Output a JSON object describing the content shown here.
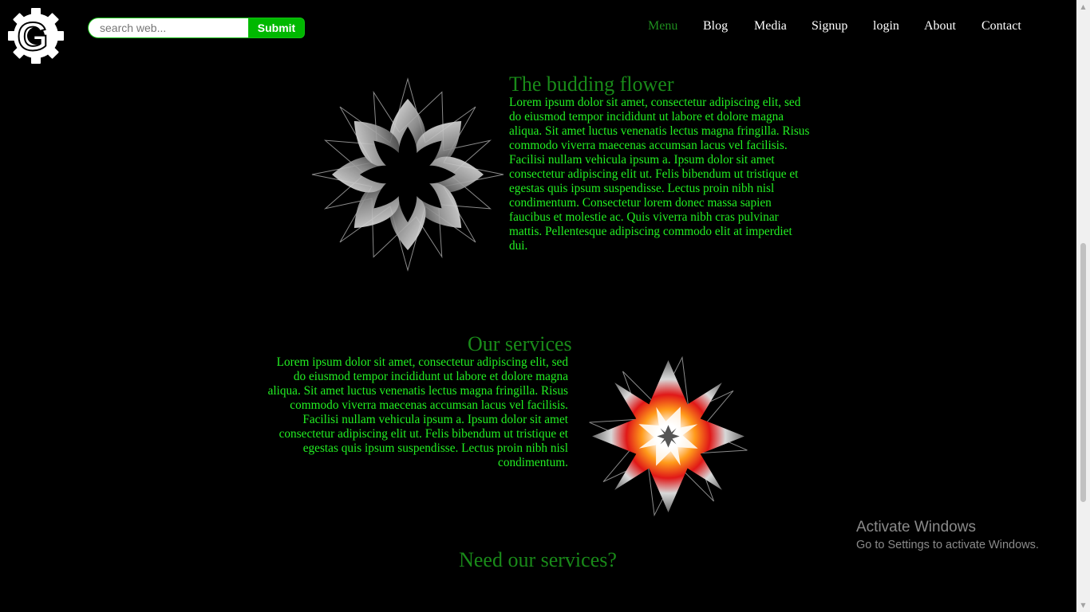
{
  "header": {
    "logo_letter": "G",
    "search": {
      "placeholder": "search web...",
      "value": ""
    },
    "submit_label": "Submit",
    "nav": [
      {
        "label": "Menu",
        "active": true
      },
      {
        "label": "Blog",
        "active": false
      },
      {
        "label": "Media",
        "active": false
      },
      {
        "label": "Signup",
        "active": false
      },
      {
        "label": "login",
        "active": false
      },
      {
        "label": "About",
        "active": false
      },
      {
        "label": "Contact",
        "active": false
      }
    ]
  },
  "sections": {
    "budding": {
      "title": "The budding flower",
      "text": "Lorem ipsum dolor sit amet, consectetur adipiscing elit, sed do eiusmod tempor incididunt ut labore et dolore magna aliqua. Sit amet luctus venenatis lectus magna fringilla. Risus commodo viverra maecenas accumsan lacus vel facilisis. Facilisi nullam vehicula ipsum a. Ipsum dolor sit amet consectetur adipiscing elit ut. Felis bibendum ut tristique et egestas quis ipsum suspendisse. Lectus proin nibh nisl condimentum. Consectetur lorem donec massa sapien faucibus et molestie ac. Quis viverra nibh cras pulvinar mattis. Pellentesque adipiscing commodo elit at imperdiet dui."
    },
    "services": {
      "title": "Our services",
      "text": "Lorem ipsum dolor sit amet, consectetur adipiscing elit, sed do eiusmod tempor incididunt ut labore et dolore magna aliqua. Sit amet luctus venenatis lectus magna fringilla. Risus commodo viverra maecenas accumsan lacus vel facilisis. Facilisi nullam vehicula ipsum a. Ipsum dolor sit amet consectetur adipiscing elit ut. Felis bibendum ut tristique et egestas quis ipsum suspendisse. Lectus proin nibh nisl condimentum."
    },
    "cta": {
      "title": "Need our services?"
    }
  },
  "watermark": {
    "title": "Activate Windows",
    "subtitle": "Go to Settings to activate Windows."
  },
  "colors": {
    "page_bg": "#000000",
    "heading_green": "#198a19",
    "body_green": "#22ee22",
    "accent_green": "#00b800",
    "nav_text": "#ffffff"
  },
  "icons": {
    "logo": "gear-g-logo-icon",
    "flower1": "white-star-flower-icon",
    "flower2": "orange-red-star-flower-icon",
    "scroll_up": "triangle-up-icon",
    "scroll_down": "triangle-down-icon"
  }
}
